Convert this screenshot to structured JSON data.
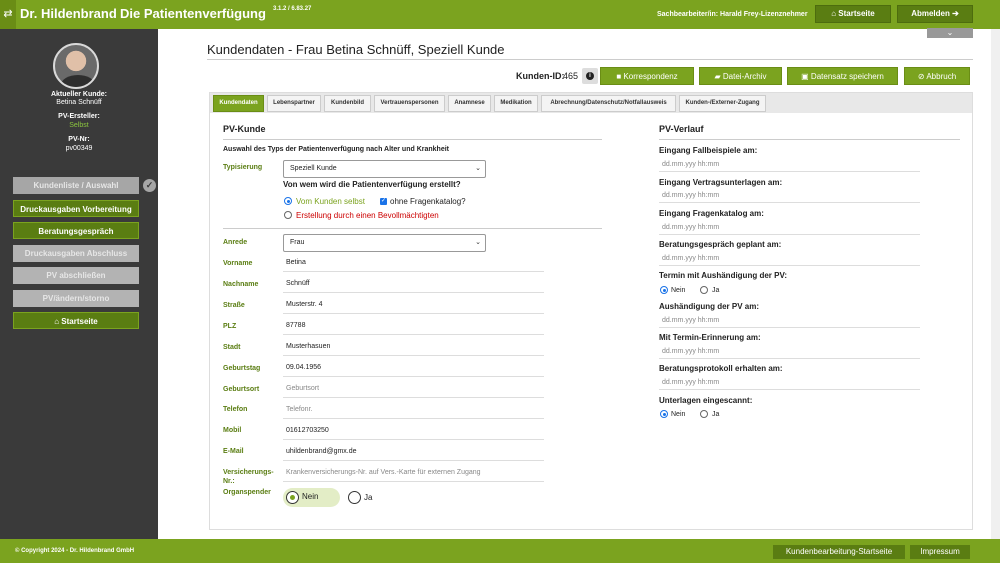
{
  "header": {
    "brand": "Dr. Hildenbrand",
    "app_title": "Die Patientenverfügung",
    "version": "3.1.2 / 6.83.27",
    "clerk": "Sachbearbeiter/in: Harald Frey-Lizenznehmer",
    "home_label": "Startseite",
    "logout_label": "Abmelden"
  },
  "sidebar": {
    "current_customer_label": "Aktueller Kunde:",
    "current_customer_value": "Betina Schnüff",
    "creator_label": "PV-Ersteller:",
    "creator_value": "Selbst",
    "pvnr_label": "PV-Nr:",
    "pvnr_value": "pv00349",
    "items": [
      {
        "label": "Kundenliste / Auswahl",
        "state": "grey"
      },
      {
        "label": "Druckausgaben Vorbereitung",
        "state": "active"
      },
      {
        "label": "Beratungsgespräch",
        "state": "active"
      },
      {
        "label": "Druckausgaben Abschluss",
        "state": "disabled"
      },
      {
        "label": "PV abschließen",
        "state": "disabled"
      },
      {
        "label": "PV/ändern/storno",
        "state": "disabled"
      },
      {
        "label": "Startseite",
        "state": "active"
      }
    ]
  },
  "page": {
    "title": "Kundendaten - Frau Betina Schnüff, Speziell Kunde",
    "kunden_id_label": "Kunden-ID:",
    "kunden_id_value": "465"
  },
  "actions": {
    "korrespondenz": "Korrespondenz",
    "archiv": "Datei-Archiv",
    "save": "Datensatz speichern",
    "cancel": "Abbruch"
  },
  "tabs": [
    "Kundendaten",
    "Lebenspartner",
    "Kundenbild",
    "Vertrauenspersonen",
    "Anamnese",
    "Medikation",
    "Abrechnung/Datenschutz/Notfallausweis",
    "Kunden-/Externer-Zugang"
  ],
  "pv_kunde": {
    "title": "PV-Kunde",
    "subhead": "Auswahl des Typs der Patientenverfügung nach Alter und Krankheit",
    "typ_label": "Typisierung",
    "typ_value": "Speziell Kunde",
    "question": "Von wem wird die Patientenverfügung erstellt?",
    "opt_self": "Vom Kunden selbst",
    "opt_catalog": "ohne Fragenkatalog?",
    "opt_proxy": "Erstellung durch einen Bevollmächtigten",
    "fields": {
      "anrede_label": "Anrede",
      "anrede_value": "Frau",
      "vorname_label": "Vorname",
      "vorname_value": "Betina",
      "nachname_label": "Nachname",
      "nachname_value": "Schnüff",
      "strasse_label": "Straße",
      "strasse_value": "Musterstr. 4",
      "plz_label": "PLZ",
      "plz_value": "87788",
      "stadt_label": "Stadt",
      "stadt_value": "Musterhasuen",
      "geburtstag_label": "Geburtstag",
      "geburtstag_value": "09.04.1956",
      "geburtsort_label": "Geburtsort",
      "geburtsort_placeholder": "Geburtsort",
      "telefon_label": "Telefon",
      "telefon_placeholder": "Telefonr.",
      "mobil_label": "Mobil",
      "mobil_value": "01612703250",
      "email_label": "E-Mail",
      "email_value": "uhildenbrand@gmx.de",
      "vers_label": "Versicherungs-Nr.:",
      "vers_placeholder": "Krankenversicherungs-Nr. auf Vers.-Karte für externen Zugang",
      "organ_label": "Organspender",
      "organ_no": "Nein",
      "organ_yes": "Ja"
    }
  },
  "pv_verlauf": {
    "title": "PV-Verlauf",
    "placeholder": "dd.mm.yyy hh:mm",
    "items": [
      "Eingang Fallbeispiele am:",
      "Eingang Vertragsunterlagen am:",
      "Eingang Fragenkatalog am:",
      "Beratungsgespräch geplant am:",
      "Termin mit Aushändigung der PV:",
      "Aushändigung der PV am:",
      "Mit Termin-Erinnerung am:",
      "Beratungsprotokoll erhalten am:",
      "Unterlagen eingescannt:"
    ],
    "no": "Nein",
    "yes": "Ja"
  },
  "footer": {
    "copyright": "© Copyright 2024 - Dr. Hildenbrand GmbH",
    "start": "Kundenbearbeitung-Startseite",
    "impressum": "Impressum"
  }
}
